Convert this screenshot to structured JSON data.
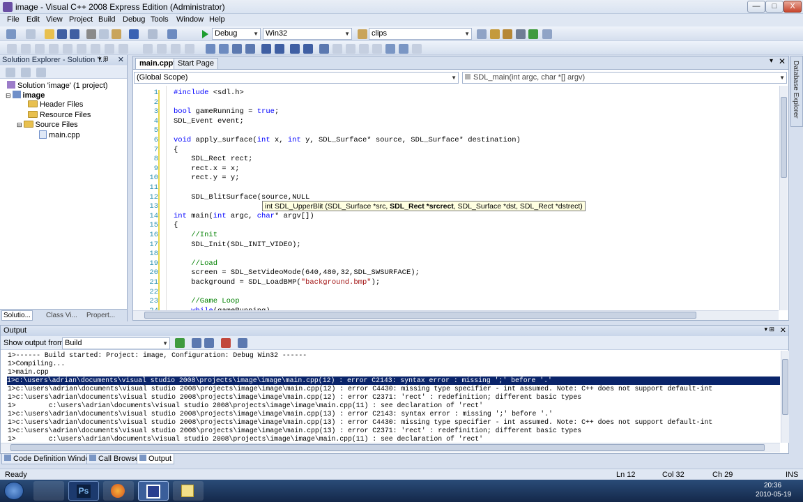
{
  "window": {
    "title": "image - Visual C++ 2008 Express Edition (Administrator)",
    "min": "—",
    "max": "□",
    "close": "X"
  },
  "menu": [
    "File",
    "Edit",
    "View",
    "Project",
    "Build",
    "Debug",
    "Tools",
    "Window",
    "Help"
  ],
  "toolbar": {
    "config": "Debug",
    "platform": "Win32",
    "find": "clips"
  },
  "solution_explorer": {
    "title": "Solution Explorer - Solution 'i...",
    "items": [
      "Solution 'image' (1 project)",
      "image",
      "Header Files",
      "Resource Files",
      "Source Files",
      "main.cpp"
    ],
    "tabs": [
      "Solutio...",
      "Class Vi...",
      "Propert..."
    ]
  },
  "editor": {
    "tabs": [
      "main.cpp*",
      "Start Page"
    ],
    "scope": "(Global Scope)",
    "function": "SDL_main(int argc, char *[] argv)",
    "side_tab": "Database Explorer",
    "lines": [
      {
        "n": "1",
        "t": "#include <sdl.h>"
      },
      {
        "n": "2",
        "t": ""
      },
      {
        "n": "3",
        "t": "bool gameRunning = true;"
      },
      {
        "n": "4",
        "t": "SDL_Event event;"
      },
      {
        "n": "5",
        "t": ""
      },
      {
        "n": "6",
        "t": "void apply_surface(int x, int y, SDL_Surface* source, SDL_Surface* destination)"
      },
      {
        "n": "7",
        "t": "{"
      },
      {
        "n": "8",
        "t": "    SDL_Rect rect;"
      },
      {
        "n": "9",
        "t": "    rect.x = x;"
      },
      {
        "n": "10",
        "t": "    rect.y = y;"
      },
      {
        "n": "11",
        "t": ""
      },
      {
        "n": "12",
        "t": "    SDL_BlitSurface(source,NULL"
      },
      {
        "n": "13",
        "t": ""
      },
      {
        "n": "14",
        "t": "int main(int argc, char* argv[])"
      },
      {
        "n": "15",
        "t": "{"
      },
      {
        "n": "16",
        "t": "    //Init"
      },
      {
        "n": "17",
        "t": "    SDL_Init(SDL_INIT_VIDEO);"
      },
      {
        "n": "18",
        "t": ""
      },
      {
        "n": "19",
        "t": "    //Load"
      },
      {
        "n": "20",
        "t": "    screen = SDL_SetVideoMode(640,480,32,SDL_SWSURFACE);"
      },
      {
        "n": "21",
        "t": "    background = SDL_LoadBMP(\"background.bmp\");"
      },
      {
        "n": "22",
        "t": ""
      },
      {
        "n": "23",
        "t": "    //Game Loop"
      },
      {
        "n": "24",
        "t": "    while(gameRunning)"
      }
    ],
    "tooltip_pre": "int SDL_UpperBlit (SDL_Surface *src, ",
    "tooltip_bold": "SDL_Rect *srcrect",
    "tooltip_post": ", SDL_Surface *dst, SDL_Rect *dstrect)"
  },
  "output": {
    "title": "Output",
    "show_from_label": "Show output from:",
    "show_from_value": "Build",
    "lines": [
      "1>------ Build started: Project: image, Configuration: Debug Win32 ------",
      "1>Compiling...",
      "1>main.cpp",
      "1>c:\\users\\adrian\\documents\\visual studio 2008\\projects\\image\\image\\main.cpp(12) : error C2143: syntax error : missing ';' before '.'",
      "1>c:\\users\\adrian\\documents\\visual studio 2008\\projects\\image\\image\\main.cpp(12) : error C4430: missing type specifier - int assumed. Note: C++ does not support default-int",
      "1>c:\\users\\adrian\\documents\\visual studio 2008\\projects\\image\\image\\main.cpp(12) : error C2371: 'rect' : redefinition; different basic types",
      "1>        c:\\users\\adrian\\documents\\visual studio 2008\\projects\\image\\image\\main.cpp(11) : see declaration of 'rect'",
      "1>c:\\users\\adrian\\documents\\visual studio 2008\\projects\\image\\image\\main.cpp(13) : error C2143: syntax error : missing ';' before '.'",
      "1>c:\\users\\adrian\\documents\\visual studio 2008\\projects\\image\\image\\main.cpp(13) : error C4430: missing type specifier - int assumed. Note: C++ does not support default-int",
      "1>c:\\users\\adrian\\documents\\visual studio 2008\\projects\\image\\image\\main.cpp(13) : error C2371: 'rect' : redefinition; different basic types",
      "1>        c:\\users\\adrian\\documents\\visual studio 2008\\projects\\image\\image\\main.cpp(11) : see declaration of 'rect'"
    ]
  },
  "bottom_tabs": [
    "Code Definition Window",
    "Call Browser",
    "Output"
  ],
  "status": {
    "ready": "Ready",
    "ln": "Ln 12",
    "col": "Col 32",
    "ch": "Ch 29",
    "ins": "INS"
  },
  "taskbar": {
    "time": "20:36",
    "date": "2010-05-19"
  }
}
